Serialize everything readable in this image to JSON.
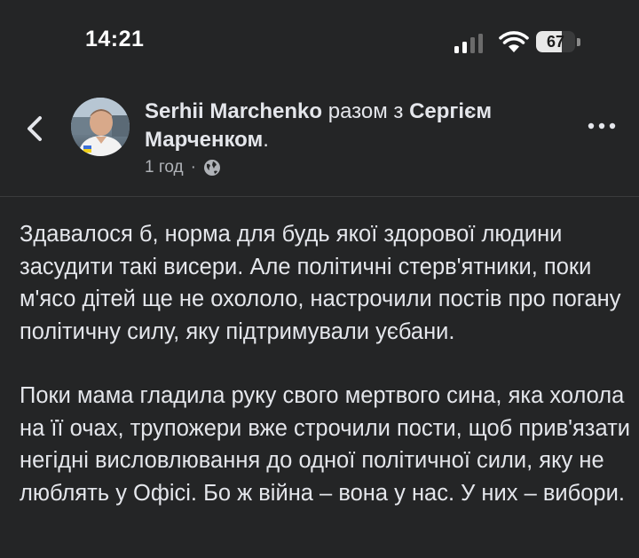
{
  "status_bar": {
    "time": "14:21",
    "battery_level": "67",
    "battery_fraction": 0.67,
    "icons": [
      "signal-icon",
      "wifi-icon",
      "battery-icon"
    ]
  },
  "header": {
    "author_name": "Serhii Marchenko",
    "connector": " разом з ",
    "tagged_name": "Сергієм Марченком",
    "tagged_suffix": ".",
    "time_ago": "1 год",
    "separator": "·",
    "icons": [
      "back-chevron-icon",
      "globe-icon",
      "more-options-icon"
    ]
  },
  "post": {
    "paragraphs": [
      "Здавалося б, норма для будь якої здорової людини засудити такі висери. Але політичні стерв'ятники, поки м'ясо дітей ще не охололо, настрочили постів про погану політичну силу, яку підтримували уєбани.",
      "Поки мама гладила руку свого мертвого сина, яка холола на її очах, трупожери вже строчили пости, щоб прив'язати негідні висловлювання до одної політичної сили, яку не люблять у Офісі. Бо ж війна – вона у нас. У них – вибори."
    ]
  },
  "colors": {
    "background": "#242526",
    "text_primary": "#e4e6eb",
    "text_secondary": "#b0b3b8"
  }
}
